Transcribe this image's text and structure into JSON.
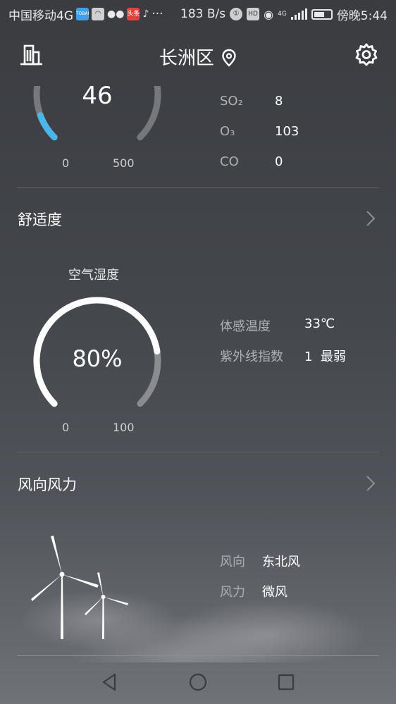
{
  "status_bar": {
    "carrier": "中国移动4G",
    "app_badges": [
      "TOBAI",
      "头条"
    ],
    "more": "···",
    "net_speed": "183 B/s",
    "hd": "HD",
    "net_type": "4G",
    "time": "傍晚5:44"
  },
  "header": {
    "title": "长洲区",
    "icons": [
      "city-list-icon",
      "location-pin-icon",
      "settings-gear-icon"
    ]
  },
  "aqi": {
    "value": "46",
    "min_label": "0",
    "max_label": "500",
    "level_fraction": 0.092,
    "accent_color": "#4ab7e8",
    "pollutants": [
      {
        "label": "SO₂",
        "value": "8"
      },
      {
        "label": "O₃",
        "value": "103"
      },
      {
        "label": "CO",
        "value": "0"
      }
    ]
  },
  "comfort": {
    "section_title": "舒适度",
    "gauge_title": "空气湿度",
    "humidity": "80%",
    "humidity_fraction": 0.8,
    "min_label": "0",
    "max_label": "100",
    "rows": [
      {
        "label": "体感温度",
        "value": "33℃"
      },
      {
        "label": "紫外线指数",
        "value": "1  最弱"
      }
    ]
  },
  "wind": {
    "section_title": "风向风力",
    "rows": [
      {
        "label": "风向",
        "value": "东北风"
      },
      {
        "label": "风力",
        "value": "微风"
      }
    ]
  },
  "nav": {
    "icons": [
      "back-triangle-icon",
      "home-circle-icon",
      "recents-square-icon"
    ]
  }
}
